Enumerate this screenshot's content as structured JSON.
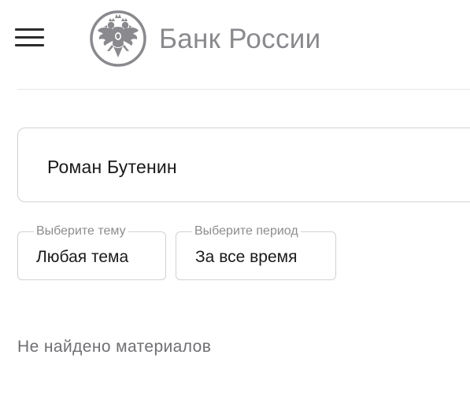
{
  "header": {
    "logo_text": "Банк России",
    "emblem_icon": "double-headed-eagle-emblem-icon",
    "menu_icon": "hamburger-menu-icon"
  },
  "search": {
    "value": "Роман Бутенин"
  },
  "filters": {
    "topic": {
      "legend": "Выберите тему",
      "value": "Любая тема"
    },
    "period": {
      "legend": "Выберите период",
      "value": "За все время"
    }
  },
  "results": {
    "empty_message": "Не найдено материалов"
  },
  "colors": {
    "logo_gray": "#8a8a8e",
    "border": "#d2d2d6",
    "muted_text": "#6f6f73"
  }
}
